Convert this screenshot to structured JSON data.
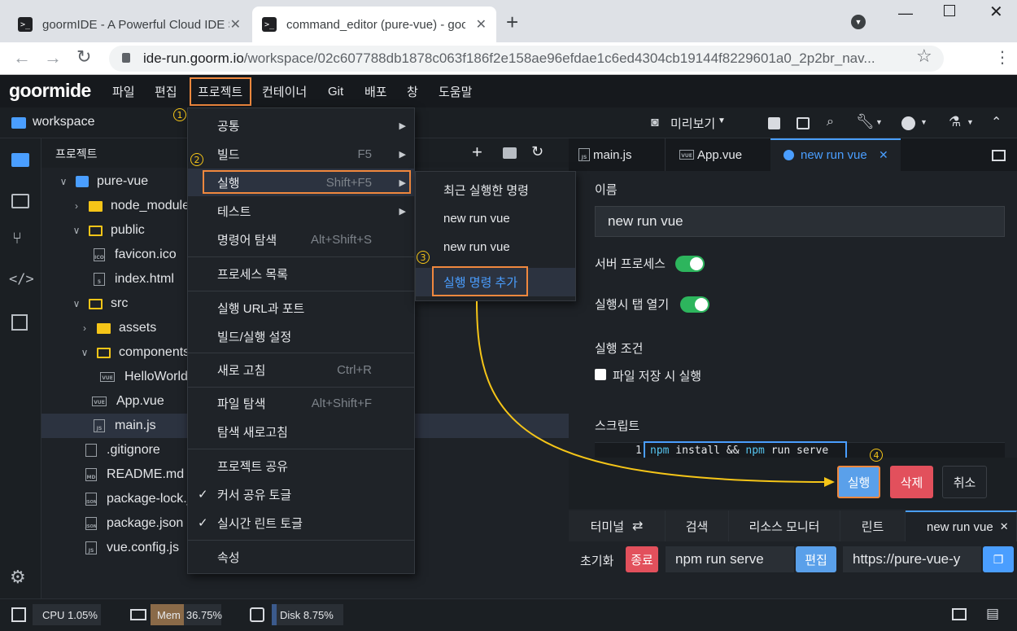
{
  "browser": {
    "tabs": [
      {
        "title": "goormIDE - A Powerful Cloud IDE Se",
        "favicon": ">_"
      },
      {
        "title": "command_editor (pure-vue) - goo",
        "favicon": ">_"
      }
    ],
    "new_tab": "+",
    "url_host": "ide-run.goorm.io",
    "url_path": "/workspace/02c607788db1878c063f186f2e158ae96efdae1c6ed4304cb19144f8229601a0_2p2br_nav..."
  },
  "app": {
    "logo": "goormide",
    "menu": [
      "파일",
      "편집",
      "프로젝트",
      "컨테이너",
      "Git",
      "배포",
      "창",
      "도움말"
    ],
    "workspace_label": "workspace",
    "preview_label": "미리보기"
  },
  "tree": {
    "header": "프로젝트",
    "items": [
      {
        "name": "pure-vue",
        "kind": "project"
      },
      {
        "name": "node_modules",
        "kind": "folder"
      },
      {
        "name": "public",
        "kind": "folder-open"
      },
      {
        "name": "favicon.ico",
        "kind": "file",
        "icon": "ICO"
      },
      {
        "name": "index.html",
        "kind": "file",
        "icon": "5"
      },
      {
        "name": "src",
        "kind": "folder-open"
      },
      {
        "name": "assets",
        "kind": "folder"
      },
      {
        "name": "components",
        "kind": "folder-open"
      },
      {
        "name": "HelloWorld",
        "kind": "file",
        "icon": "VUE"
      },
      {
        "name": "App.vue",
        "kind": "file",
        "icon": "VUE"
      },
      {
        "name": "main.js",
        "kind": "file",
        "icon": "JS"
      },
      {
        "name": ".gitignore",
        "kind": "file",
        "icon": ""
      },
      {
        "name": "README.md",
        "kind": "file",
        "icon": "MD"
      },
      {
        "name": "package-lock.j",
        "kind": "file",
        "icon": "JSON"
      },
      {
        "name": "package.json",
        "kind": "file",
        "icon": "JSON"
      },
      {
        "name": "vue.config.js",
        "kind": "file",
        "icon": "JS"
      }
    ]
  },
  "project_menu": {
    "items": [
      {
        "label": "공통",
        "shortcut": "",
        "arrow": true
      },
      {
        "label": "빌드",
        "shortcut": "F5",
        "arrow": true
      },
      {
        "label": "실행",
        "shortcut": "Shift+F5",
        "arrow": true
      },
      {
        "label": "테스트",
        "shortcut": "",
        "arrow": true
      },
      {
        "label": "명령어 탐색",
        "shortcut": "Alt+Shift+S",
        "arrow": false
      },
      {
        "label": "프로세스 목록",
        "shortcut": "",
        "arrow": false
      },
      {
        "label": "실행 URL과 포트",
        "shortcut": "",
        "arrow": false
      },
      {
        "label": "빌드/실행 설정",
        "shortcut": "",
        "arrow": false
      },
      {
        "label": "새로 고침",
        "shortcut": "Ctrl+R",
        "arrow": false
      },
      {
        "label": "파일 탐색",
        "shortcut": "Alt+Shift+F",
        "arrow": false
      },
      {
        "label": "탐색 새로고침",
        "shortcut": "",
        "arrow": false
      },
      {
        "label": "프로젝트 공유",
        "shortcut": "",
        "arrow": false
      },
      {
        "label": "커서 공유 토글",
        "shortcut": "",
        "arrow": false,
        "checked": true
      },
      {
        "label": "실시간 린트 토글",
        "shortcut": "",
        "arrow": false,
        "checked": true
      },
      {
        "label": "속성",
        "shortcut": "",
        "arrow": false
      }
    ],
    "check_mark": "✓"
  },
  "run_submenu": [
    "최근 실행한 명령",
    "new run vue",
    "new run vue",
    "실행 명령 추가"
  ],
  "annotations": [
    "1",
    "2",
    "3",
    "4"
  ],
  "editor": {
    "tabs": [
      {
        "label": "main.js",
        "icon": "JS"
      },
      {
        "label": "App.vue",
        "icon": "VUE"
      },
      {
        "label": "new run vue",
        "icon": "",
        "close": "✕"
      }
    ],
    "name_label": "이름",
    "name_value": "new run vue",
    "server_process_label": "서버 프로세스",
    "server_process_on": true,
    "open_tab_label": "실행시 탭 열기",
    "open_tab_on": true,
    "condition_label": "실행 조건",
    "save_run_label": "파일 저장 시 실행",
    "script_label": "스크립트",
    "script_line_no": "1",
    "script_tokens": [
      {
        "text": "npm",
        "kind": "kw"
      },
      {
        "text": " install && ",
        "kind": "plain"
      },
      {
        "text": "npm",
        "kind": "kw"
      },
      {
        "text": " run serve",
        "kind": "plain"
      }
    ],
    "run_button": "실행",
    "delete_button": "삭제",
    "cancel_button": "취소"
  },
  "bottom_panel": {
    "tabs": [
      "터미널",
      "검색",
      "리소스 모니터",
      "린트",
      "new run vue"
    ],
    "init_label": "초기화",
    "stop_button": "종료",
    "command_value": "npm run serve",
    "edit_button": "편집",
    "url_value": "https://pure-vue-y"
  },
  "status": {
    "cpu_label": "CPU",
    "cpu_value": "1.05%",
    "mem_label": "Mem",
    "mem_value": "36.75%",
    "disk_label": "Disk",
    "disk_value": "8.75%"
  },
  "colors": {
    "accent": "#4a9eff",
    "highlight_box": "#f0883e",
    "run_button": "#5aa0ea",
    "delete_button": "#e2505c",
    "toggle_on": "#2db55d",
    "arrow": "#f5c518"
  }
}
